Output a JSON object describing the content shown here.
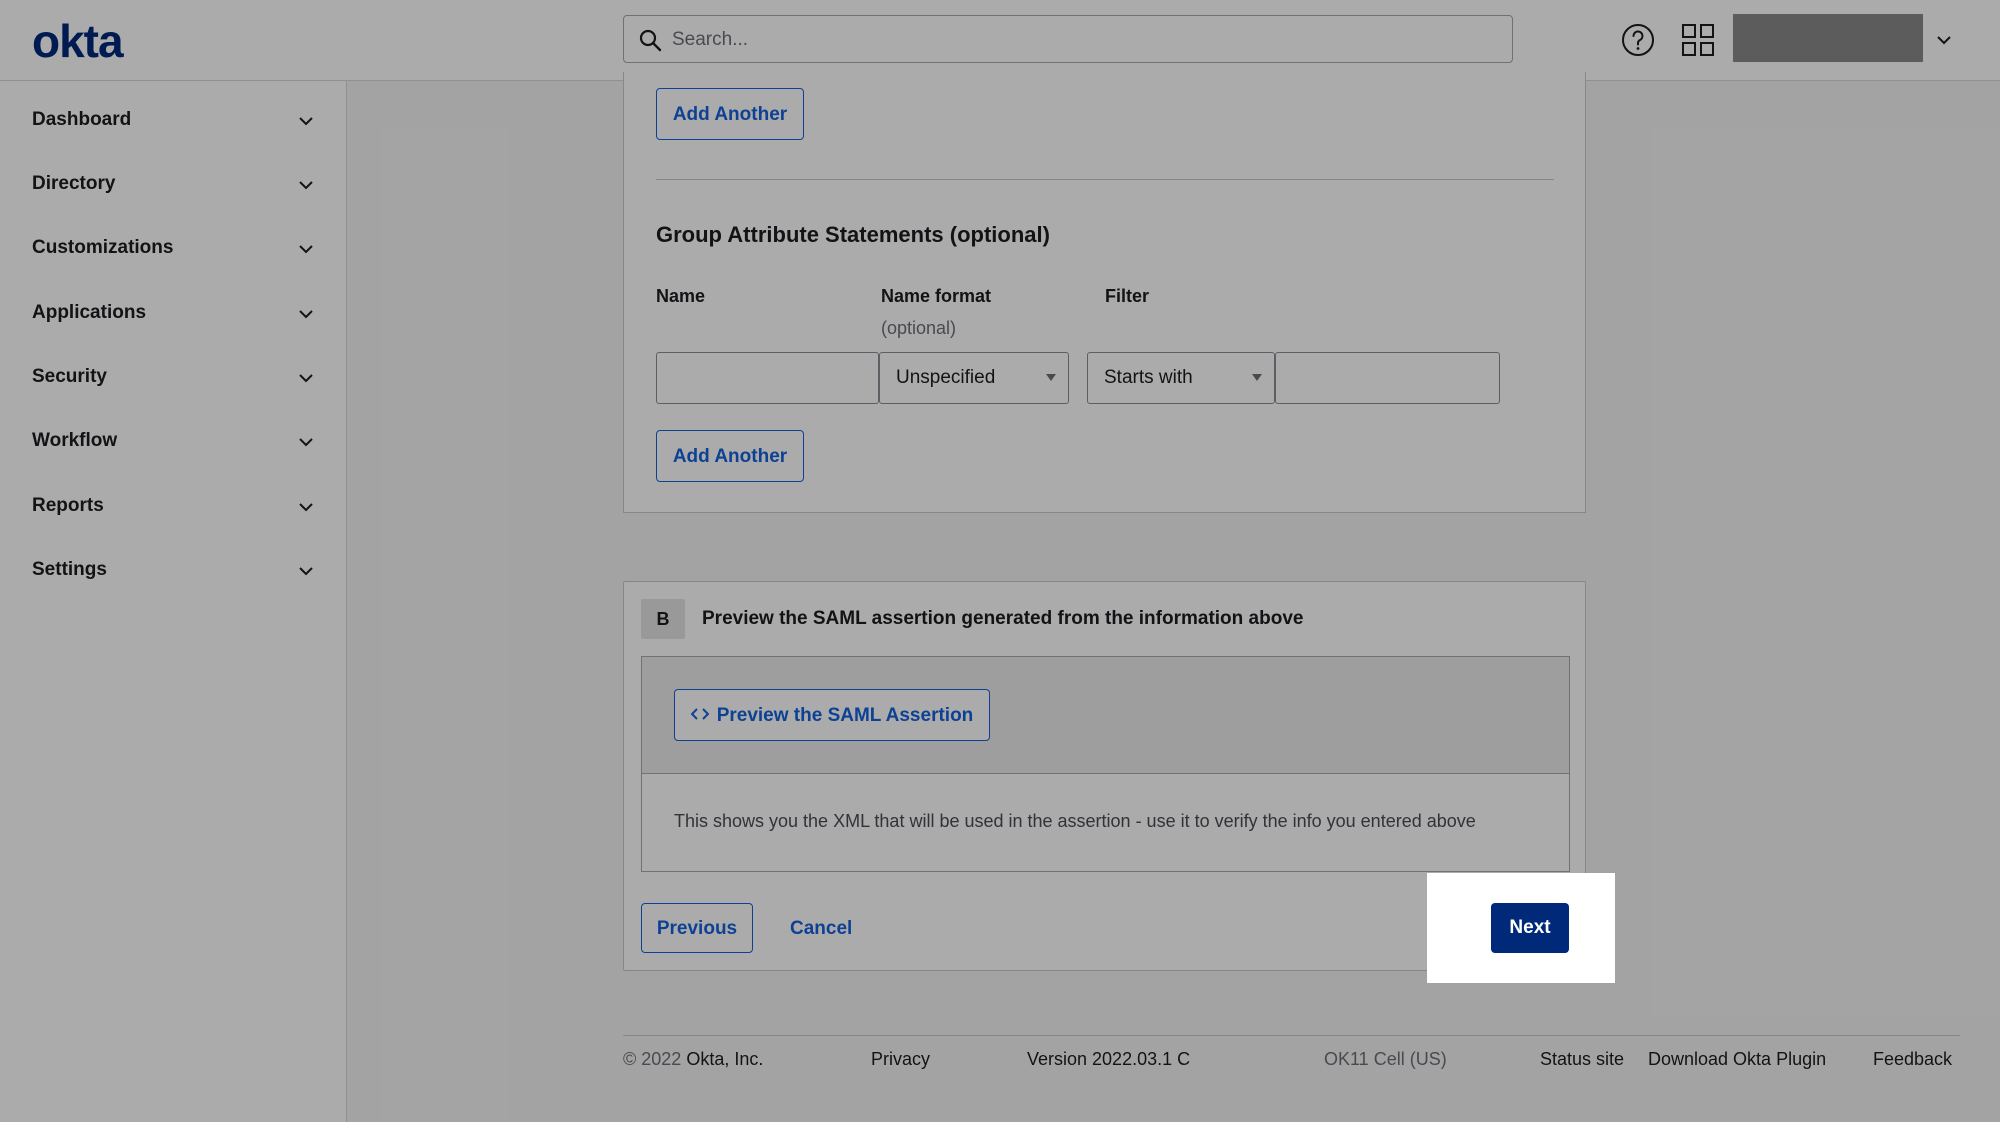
{
  "header": {
    "logo": "okta",
    "search": {
      "placeholder": "Search...",
      "value": ""
    },
    "help_icon": "help-circle-icon",
    "apps_icon": "app-grid-icon"
  },
  "sidebar": {
    "items": [
      {
        "label": "Dashboard"
      },
      {
        "label": "Directory"
      },
      {
        "label": "Customizations"
      },
      {
        "label": "Applications"
      },
      {
        "label": "Security"
      },
      {
        "label": "Workflow"
      },
      {
        "label": "Reports"
      },
      {
        "label": "Settings"
      }
    ]
  },
  "attributes": {
    "add_another_label": "Add Another",
    "group_section_title": "Group Attribute Statements (optional)",
    "columns": {
      "name": "Name",
      "name_format": "Name format",
      "name_format_sub": "(optional)",
      "filter": "Filter"
    },
    "row": {
      "name_value": "",
      "name_format_value": "Unspecified",
      "filter_type_value": "Starts with",
      "filter_value": ""
    },
    "group_add_another_label": "Add Another"
  },
  "preview": {
    "step_badge": "B",
    "step_title": "Preview the SAML assertion generated from the information above",
    "button_label": "Preview the SAML Assertion",
    "description": "This shows you the XML that will be used in the assertion - use it to verify the info you entered above"
  },
  "actions": {
    "previous_label": "Previous",
    "cancel_label": "Cancel",
    "next_label": "Next"
  },
  "footer": {
    "copyright_symbol_year": "© 2022",
    "company": "Okta, Inc.",
    "privacy": "Privacy",
    "version": "Version 2022.03.1 C",
    "cell": "OK11 Cell (US)",
    "status_site": "Status site",
    "download_plugin": "Download Okta Plugin",
    "feedback": "Feedback"
  },
  "colors": {
    "brand": "#00297a",
    "accent": "#1662dd",
    "overlay": "rgba(0,0,0,0.33)"
  }
}
